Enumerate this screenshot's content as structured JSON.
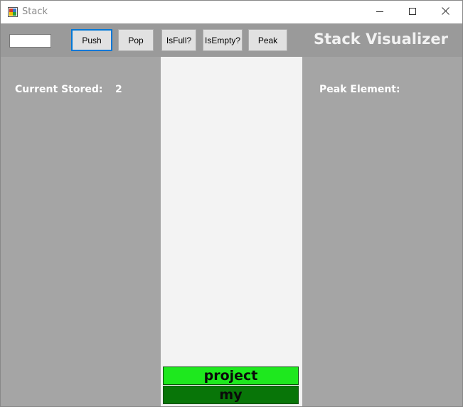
{
  "window": {
    "title": "Stack"
  },
  "toolbar": {
    "input_value": "",
    "buttons": {
      "push": "Push",
      "pop": "Pop",
      "isfull": "IsFull?",
      "isempty": "IsEmpty?",
      "peak": "Peak"
    },
    "app_title": "Stack Visualizer"
  },
  "left_panel": {
    "label": "Current Stored:",
    "value": "2"
  },
  "right_panel": {
    "label": "Peak Element:"
  },
  "stack": {
    "items": [
      "project",
      "my"
    ]
  },
  "colors": {
    "background": "#a5a5a5",
    "toolbar": "#9a9a9a",
    "stack_area": "#f3f3f3",
    "top_item": "#1ee81e",
    "bottom_item": "#087508",
    "focus_border": "#0078d7"
  },
  "icons": {
    "app": "app-window-icon",
    "minimize": "minimize-icon",
    "maximize": "maximize-icon",
    "close": "close-icon"
  }
}
